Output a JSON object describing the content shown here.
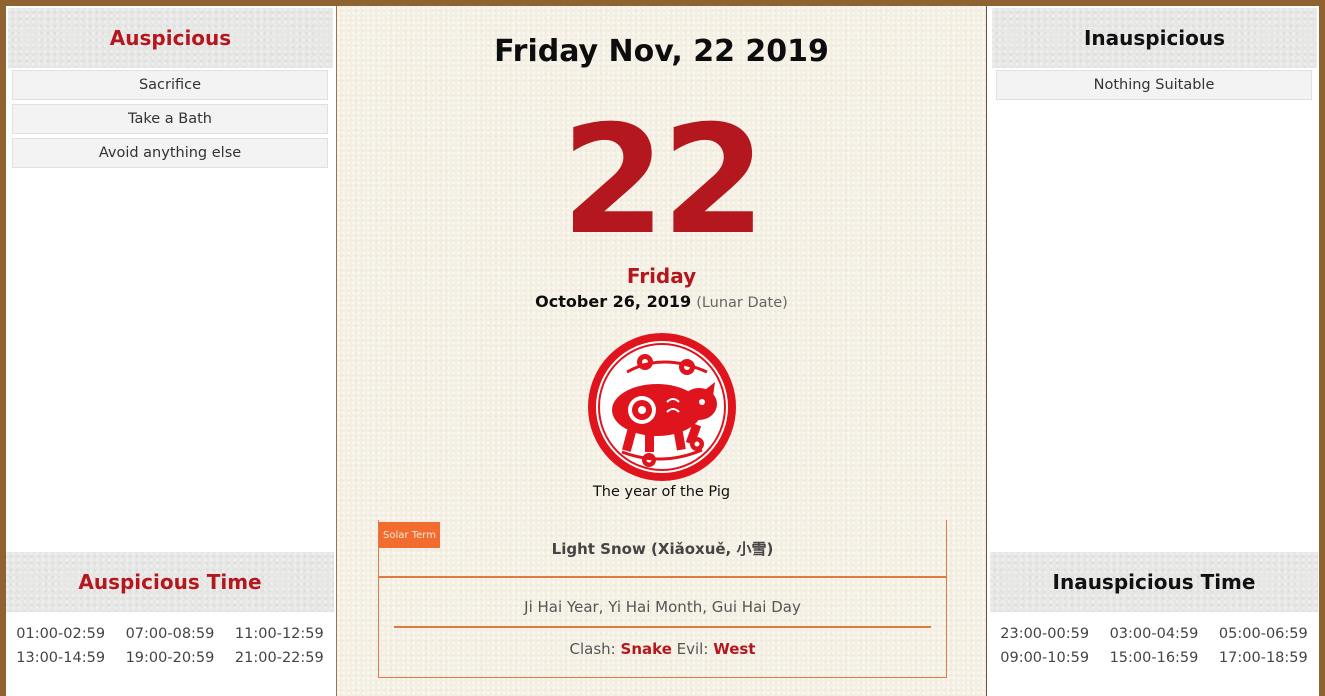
{
  "auspicious": {
    "title": "Auspicious",
    "items": [
      "Sacrifice",
      "Take a Bath",
      "Avoid anything else"
    ]
  },
  "inauspicious": {
    "title": "Inauspicious",
    "items": [
      "Nothing Suitable"
    ]
  },
  "auspicious_time": {
    "title": "Auspicious Time",
    "slots": [
      "01:00-02:59",
      "07:00-08:59",
      "11:00-12:59",
      "13:00-14:59",
      "19:00-20:59",
      "21:00-22:59"
    ]
  },
  "inauspicious_time": {
    "title": "Inauspicious Time",
    "slots": [
      "23:00-00:59",
      "03:00-04:59",
      "05:00-06:59",
      "09:00-10:59",
      "15:00-16:59",
      "17:00-18:59"
    ]
  },
  "main": {
    "full_date": "Friday Nov, 22 2019",
    "day_number": "22",
    "weekday": "Friday",
    "lunar_date": "October 26, 2019",
    "lunar_label": "(Lunar Date)",
    "zodiac_icon": "pig-papercut-icon",
    "zodiac_caption": "The year of the Pig",
    "solar_term_badge": "Solar Term",
    "solar_term": "Light Snow (Xiǎoxuě, 小雪)",
    "ganzhi": "Ji Hai Year, Yi Hai Month, Gui Hai Day",
    "clash_label": "Clash:",
    "clash_value": "Snake",
    "evil_label": "Evil:",
    "evil_value": "West"
  },
  "colors": {
    "frame": "#8f6232",
    "accent_red": "#b5171e",
    "solar_term_orange": "#f26c2f",
    "paper": "#f4efe3"
  }
}
